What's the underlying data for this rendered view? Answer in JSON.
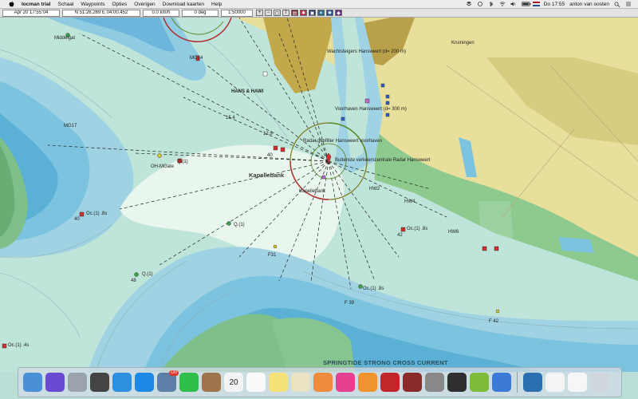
{
  "menubar": {
    "app_name": "locman trial",
    "items": [
      "Schaal",
      "Waypoints",
      "Opties",
      "Overigen",
      "Download kaarten",
      "Help"
    ],
    "clock": "Do 17:55",
    "user": "anton van oosten"
  },
  "toolbar": {
    "datetime": "Apr 20 17:55:04",
    "position": "N 51:26.269 E 04:00.452",
    "speed": "0.0  km/h",
    "heading": "0 deg",
    "scale": "1:50000",
    "icons": [
      "zoom-in-icon",
      "zoom-out-icon",
      "zoom-fit-icon",
      "text-icon",
      "chart-layer-icon",
      "settings-icon",
      "photo-icon",
      "star-icon",
      "globe-icon",
      "filter-icon"
    ]
  },
  "map": {
    "labels": {
      "middelgat": "Middelgat",
      "mg14": "MG14",
      "hans_hawi": "HANS & HAWI",
      "wachtsteiger": "Wachtsteigers Hansweert (d= 200 m)",
      "voorhaven": "Voorhaven Hansweert (d= 300 m)",
      "radar_gapfiller": "Radar gapfiller Hansweert voorhaven",
      "verkeerscentrale": "Buitenste verkeerscentrale Radar Hansweert",
      "kapellebank": "Kapellebank",
      "kapellebank_small": "Kapellebank",
      "kruiningen": "Kruiningen",
      "mg17": "MG17",
      "oh_mgate": "OH-MGate",
      "q1_a": "Q.(1)",
      "q1_b": "Q.(1)",
      "n40": "40",
      "n40_b": "40",
      "oc1_8s_left": "Oc.(1) .8s",
      "n48": "48",
      "q1_c": "Q.(1)",
      "hw2": "HW2",
      "hw4": "HW4",
      "hw6": "HW6",
      "oc1_8s_right": "Oc.(1) .8s",
      "n42": "42",
      "f31": "F31",
      "oc1_8s_mid": "Oc.(1) .8s",
      "f39": "F 39",
      "f42": "F 42",
      "oc1_4s": "Oc.(1) .4s",
      "depth_154": "15.4",
      "depth_129": "12.9",
      "springtide": "SPRINGTIDE STRONG CROSS CURRENT"
    }
  },
  "dock": {
    "apps": [
      {
        "name": "finder-icon",
        "color": "#4a90d9"
      },
      {
        "name": "siri-icon",
        "color": "#6a4ad0"
      },
      {
        "name": "launchpad-icon",
        "color": "#9aa3ad"
      },
      {
        "name": "mission-control-icon",
        "color": "#444"
      },
      {
        "name": "safari-icon",
        "color": "#2d8fe0"
      },
      {
        "name": "app-store-icon",
        "color": "#1e88e5"
      },
      {
        "name": "preview-icon",
        "color": "#5b7fa6",
        "badge": "120"
      },
      {
        "name": "facetime-icon",
        "color": "#2fbf4a"
      },
      {
        "name": "contacts-icon",
        "color": "#a0744a"
      },
      {
        "name": "calendar-icon",
        "color": "#f3f3f3",
        "text": "20"
      },
      {
        "name": "reminders-icon",
        "color": "#fafafa"
      },
      {
        "name": "notes-icon",
        "color": "#f7e27a"
      },
      {
        "name": "stickies-icon",
        "color": "#e9e3c4"
      },
      {
        "name": "photos-icon",
        "color": "#f08a3c"
      },
      {
        "name": "itunes-icon",
        "color": "#e53f8f"
      },
      {
        "name": "ibooks-icon",
        "color": "#f19430"
      },
      {
        "name": "photo-booth-icon",
        "color": "#c0262a"
      },
      {
        "name": "hotel-app-icon",
        "color": "#8b2a2a"
      },
      {
        "name": "system-preferences-icon",
        "color": "#888"
      },
      {
        "name": "calculator-icon",
        "color": "#2f2f2f"
      },
      {
        "name": "android-studio-icon",
        "color": "#7dbb3a"
      },
      {
        "name": "xcode-icon",
        "color": "#3b7ad6"
      },
      {
        "name": "world-globe-icon",
        "color": "#2a6fb0"
      },
      {
        "name": "document-icon",
        "color": "#f4f4f4"
      },
      {
        "name": "textedit-icon",
        "color": "#f6f6f6"
      },
      {
        "name": "trash-icon",
        "color": "#cfd6dc"
      }
    ]
  }
}
